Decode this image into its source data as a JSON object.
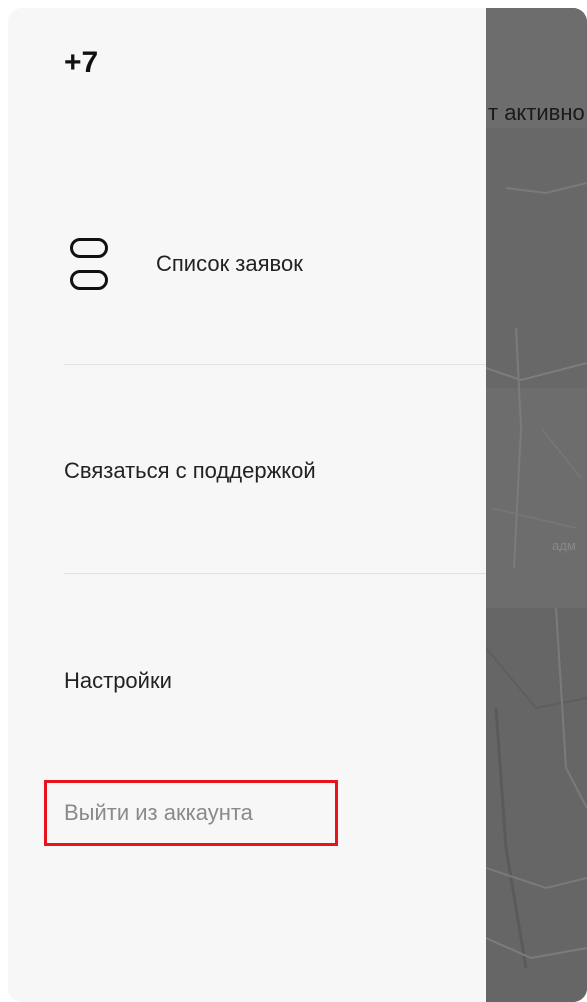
{
  "drawer": {
    "phone": "+7",
    "items": [
      {
        "label": "Список заявок",
        "icon": "list-icon"
      },
      {
        "label": "Связаться с поддержкой"
      },
      {
        "label": "Настройки"
      },
      {
        "label": "Выйти из аккаунта"
      }
    ]
  },
  "background": {
    "header_text": "т активно",
    "map_label": "адм"
  },
  "colors": {
    "drawer_bg": "#f7f7f7",
    "map_bg": "#6e6e6e",
    "highlight": "#e8141b"
  }
}
